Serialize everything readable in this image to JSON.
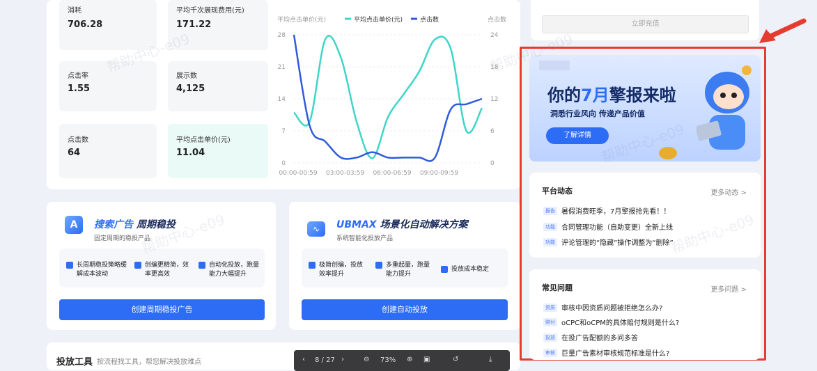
{
  "metrics": [
    {
      "label": "消耗",
      "value": "706.28"
    },
    {
      "label": "平均千次展现费用(元)",
      "value": "171.22"
    },
    {
      "label": "点击率",
      "value": "1.55"
    },
    {
      "label": "展示数",
      "value": "4,125"
    },
    {
      "label": "点击数",
      "value": "64"
    },
    {
      "label": "平均点击单价(元)",
      "value": "11.04"
    }
  ],
  "chart_data": {
    "type": "line",
    "left_axis_label": "平均点击单价(元)",
    "right_axis_label": "点击数",
    "legend": [
      "平均点击单价(元)",
      "点击数"
    ],
    "y_left_ticks": [
      "28",
      "21",
      "14",
      "7",
      "0"
    ],
    "y_right_ticks": [
      "24",
      "18",
      "12",
      "6",
      "0"
    ],
    "x_ticks": [
      "00:00-00:59",
      "03:00-03:59",
      "06:00-06:59",
      "09:00-09:59"
    ],
    "ylim_left": [
      0,
      28
    ],
    "ylim_right": [
      0,
      24
    ],
    "x": [
      0,
      1,
      2,
      3,
      4,
      5,
      6,
      7,
      8,
      9,
      10,
      11,
      12
    ],
    "series": [
      {
        "name": "平均点击单价(元)",
        "axis": "left",
        "color": "#3dd6c8",
        "values": [
          11,
          9,
          27,
          23,
          9,
          1,
          10,
          15,
          20,
          27,
          25,
          7,
          12
        ]
      },
      {
        "name": "点击数",
        "axis": "right",
        "color": "#2f5bdb",
        "values": [
          24,
          7,
          4,
          1,
          1,
          2,
          1,
          1,
          1,
          1,
          10,
          11,
          12
        ]
      }
    ]
  },
  "promo1": {
    "title_a": "搜索广告",
    "title_b": "周期稳投",
    "subtitle": "固定周期的稳投产品",
    "features": [
      "长周期稳投策略缓解成本波动",
      "创编更精简，效率更高效",
      "自动化投放，跑量能力大幅提升"
    ],
    "button": "创建周期稳投广告"
  },
  "promo2": {
    "title_a": "UBMAX",
    "title_b": "场景化自动解决方案",
    "subtitle": "系统智能化投放产品",
    "features": [
      "极简创编，投放效率提升",
      "多重起量，跑量能力提升",
      "投放成本稳定"
    ],
    "button": "创建自动投放"
  },
  "bottom": {
    "title": "投放工具",
    "subtitle": "按流程找工具，帮您解决投放难点"
  },
  "pdf_toolbar": {
    "page": "8 / 27",
    "zoom": "73%"
  },
  "right": {
    "recharge": "立即充值",
    "banner": {
      "title_a": "你的",
      "title_b": "7月",
      "title_c": "擎报来啦",
      "subtitle": "洞悉行业风向 传递产品价值",
      "button": "了解详情"
    },
    "news": {
      "title": "平台动态",
      "more": "更多动态 >",
      "items": [
        {
          "tag": "报告",
          "text": "暑假消费旺季，7月擎报抢先看！！"
        },
        {
          "tag": "功能",
          "text": "合同管理功能（自助变更）全新上线"
        },
        {
          "tag": "功能",
          "text": "评论管理的“隐藏”操作调整为“删除”"
        }
      ]
    },
    "faq": {
      "title": "常见问题",
      "more": "更多问题 >",
      "items": [
        {
          "tag": "资质",
          "text": "审核中因资质问题被拒绝怎么办?"
        },
        {
          "tag": "赔付",
          "text": "oCPC和oCPM的具体赔付规则是什么?"
        },
        {
          "tag": "投放",
          "text": "在投广告配额的多问多答"
        },
        {
          "tag": "审核",
          "text": "巨量广告素材审核规范标准是什么?"
        }
      ]
    }
  },
  "watermark": "帮助中心-e09"
}
